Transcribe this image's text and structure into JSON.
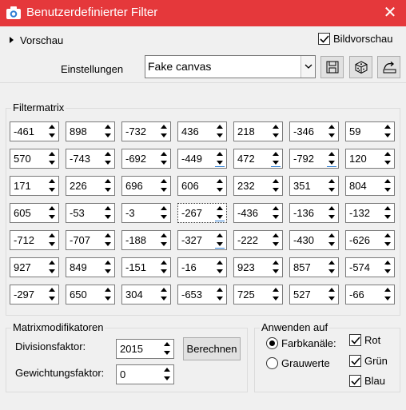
{
  "window": {
    "title": "Benutzerdefinierter Filter",
    "close_glyph": "✕"
  },
  "top": {
    "preview_label": "Vorschau",
    "image_preview_label": "Bildvorschau",
    "image_preview_checked": true,
    "settings_label": "Einstellungen",
    "settings_value": "Fake canvas"
  },
  "matrix": {
    "legend": "Filtermatrix",
    "rows": [
      [
        "-461",
        "898",
        "-732",
        "436",
        "218",
        "-346",
        "59"
      ],
      [
        "570",
        "-743",
        "-692",
        "-449",
        "472",
        "-792",
        "120"
      ],
      [
        "171",
        "226",
        "696",
        "606",
        "232",
        "351",
        "804"
      ],
      [
        "605",
        "-53",
        "-3",
        "-267",
        "-436",
        "-136",
        "-132"
      ],
      [
        "-712",
        "-707",
        "-188",
        "-327",
        "-222",
        "-430",
        "-626"
      ],
      [
        "927",
        "849",
        "-151",
        "-16",
        "923",
        "857",
        "-574"
      ],
      [
        "-297",
        "650",
        "304",
        "-653",
        "725",
        "527",
        "-66"
      ]
    ]
  },
  "modifiers": {
    "legend": "Matrixmodifikatoren",
    "division_label": "Divisionsfaktor:",
    "division_value": "2015",
    "weight_label": "Gewichtungsfaktor:",
    "weight_value": "0",
    "calc_button": "Berechnen"
  },
  "apply": {
    "legend": "Anwenden auf",
    "color_channels_label": "Farbkanäle:",
    "grayscale_label": "Grauwerte",
    "selected": "Farbkanäle:",
    "red_label": "Rot",
    "green_label": "Grün",
    "blue_label": "Blau",
    "red_checked": true,
    "green_checked": true,
    "blue_checked": true
  },
  "colors": {
    "titlebar": "#e5383b",
    "accent": "#2b7cd3"
  },
  "icons": [
    "camera-icon",
    "close-icon",
    "save-icon",
    "dice-icon",
    "reset-icon"
  ]
}
